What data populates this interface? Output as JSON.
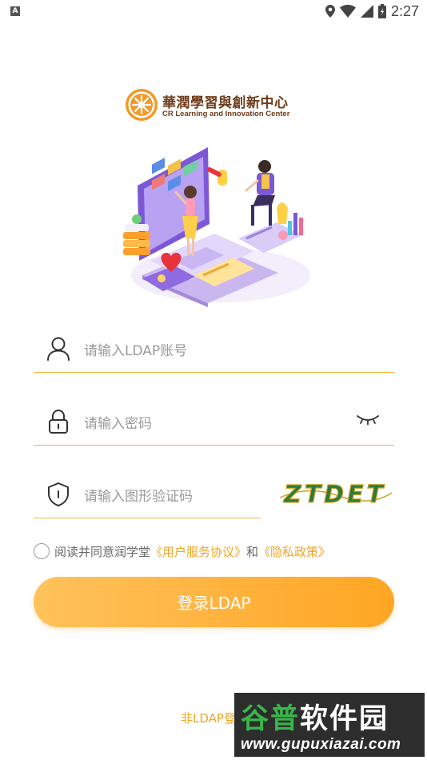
{
  "status_bar": {
    "time": "2:27",
    "left_icon_letter": "A"
  },
  "logo": {
    "name_cn": "華潤學習與創新中心",
    "name_en": "CR Learning and Innovation Center"
  },
  "form": {
    "username_placeholder": "请输入LDAP账号",
    "password_placeholder": "请输入密码",
    "captcha_placeholder": "请输入图形验证码",
    "captcha_text": "ZTDET"
  },
  "agreement": {
    "prefix": "阅读并同意润学堂",
    "terms_link": "《用户服务协议》",
    "conjunction": "和",
    "privacy_link": "《隐私政策》"
  },
  "login_button_label": "登录LDAP",
  "alt_login_label": "非LDAP登",
  "watermark": {
    "top_text_green": "谷普",
    "top_text_white": "软件园",
    "bottom_text": "www.gupuxiazai.com"
  },
  "colors": {
    "accent": "#f5b638",
    "button_start": "#ffc25c",
    "button_end": "#ffa623",
    "logo_brown": "#6e3b1a"
  }
}
